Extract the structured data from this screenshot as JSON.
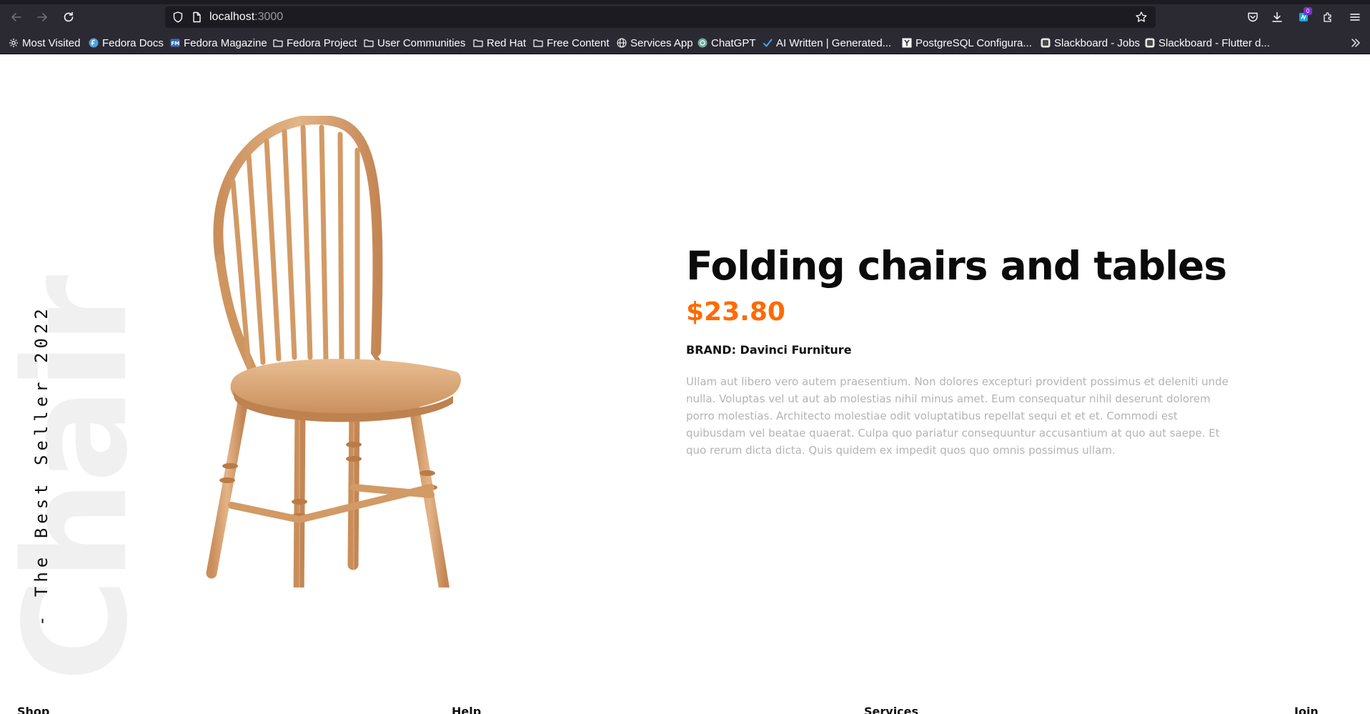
{
  "browser": {
    "url_host": "localhost",
    "url_port": ":3000",
    "extension_badge": "0",
    "bookmarks": [
      {
        "label": "Most Visited",
        "icon": "gear-icon"
      },
      {
        "label": "Fedora Docs",
        "icon": "fedora-icon"
      },
      {
        "label": "Fedora Magazine",
        "icon": "fedora-magazine-icon"
      },
      {
        "label": "Fedora Project",
        "icon": "folder-icon"
      },
      {
        "label": "User Communities",
        "icon": "folder-icon"
      },
      {
        "label": "Red Hat",
        "icon": "folder-icon"
      },
      {
        "label": "Free Content",
        "icon": "folder-icon"
      },
      {
        "label": "Services App",
        "icon": "globe-icon"
      },
      {
        "label": "ChatGPT",
        "icon": "chatgpt-icon"
      },
      {
        "label": "AI Written | Generated...",
        "icon": "checkmark-icon"
      },
      {
        "label": "PostgreSQL Configura...",
        "icon": "y-icon"
      },
      {
        "label": "Slackboard - Jobs",
        "icon": "slackboard-icon"
      },
      {
        "label": "Slackboard - Flutter d...",
        "icon": "slackboard-icon"
      }
    ],
    "colors": {
      "chrome": "#2b2a33",
      "urlbar": "#1c1b22"
    }
  },
  "hero": {
    "background_word": "Chair",
    "vertical_tag": "- The Best Seller 2022",
    "image_alt": "wooden chair"
  },
  "product": {
    "title": "Folding chairs and tables",
    "price": "$23.80",
    "brand_label": "BRAND: ",
    "brand_value": "Davinci Furniture",
    "description": "Ullam aut libero vero autem praesentium. Non dolores excepturi provident possimus et deleniti unde nulla. Voluptas vel ut aut ab molestias nihil minus amet. Eum consequatur nihil deserunt dolorem porro molestias. Architecto molestiae odit voluptatibus repellat sequi et et et. Commodi est quibusdam vel beatae quaerat. Culpa quo pariatur consequuntur accusantium at quo aut saepe. Et quo rerum dicta dicta. Quis quidem ex impedit quos quo omnis possimus ullam.",
    "colors": {
      "price": "#ff6a00",
      "description": "#b4b4b4"
    }
  },
  "footer": {
    "links": [
      "Shop",
      "Help",
      "Services",
      "Join"
    ]
  }
}
